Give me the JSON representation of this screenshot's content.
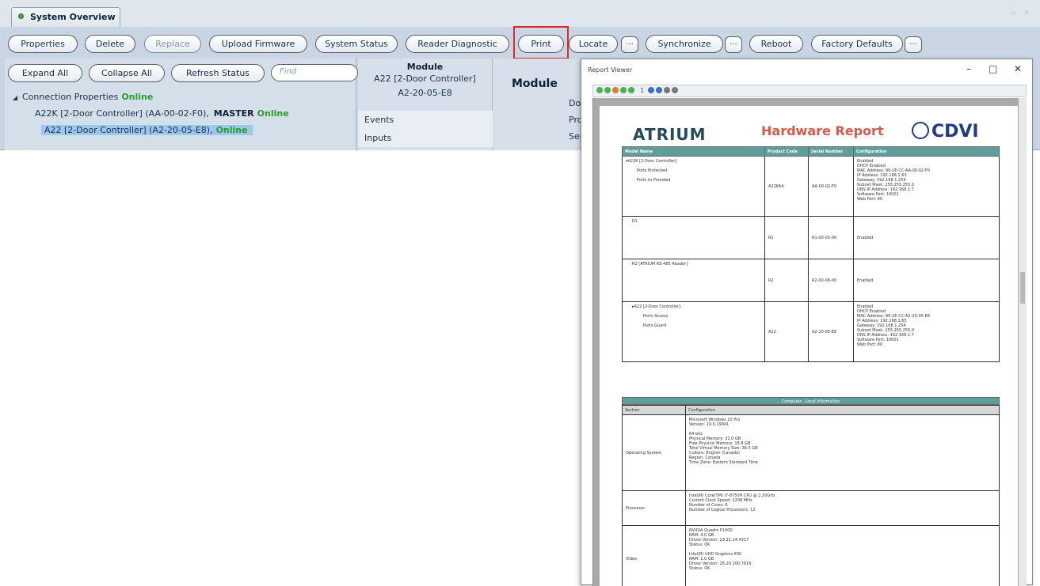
{
  "tab": {
    "title": "System Overview"
  },
  "toolbar": {
    "properties": "Properties",
    "delete": "Delete",
    "replace": "Replace",
    "upload_firmware": "Upload Firmware",
    "system_status": "System Status",
    "reader_diagnostic": "Reader Diagnostic",
    "print": "Print",
    "locate": "Locate",
    "synchronize": "Synchronize",
    "reboot": "Reboot",
    "factory_defaults": "Factory Defaults",
    "more": "..."
  },
  "tree_toolbar": {
    "expand_all": "Expand All",
    "collapse_all": "Collapse All",
    "refresh_status": "Refresh Status",
    "find_placeholder": "Find"
  },
  "tree": {
    "root": {
      "label": "Connection Properties",
      "status": "Online"
    },
    "items": [
      {
        "label": "A22K [2-Door Controller] (AA-00-02-F0),",
        "role": "MASTER",
        "status": "Online"
      },
      {
        "label": "A22 [2-Door Controller] (A2-20-05-E8),",
        "status": "Online"
      }
    ]
  },
  "module_panel": {
    "title": "Module",
    "device": "A22 [2-Door Controller]",
    "address": "A2-20-05-E8",
    "list": [
      "Events",
      "Inputs"
    ]
  },
  "details": {
    "title": "Module",
    "labels": [
      "Do",
      "Pro",
      "Ser"
    ]
  },
  "report_viewer": {
    "window_title": "Report Viewer",
    "page_indicator": "1",
    "header": {
      "brand_left": "ATRIUM",
      "title": "Hardware Report",
      "brand_right": "CDVI"
    },
    "hw_columns": [
      "Model Name",
      "Product Code",
      "Serial Number",
      "Configuration"
    ],
    "hw_rows": [
      {
        "names": [
          "▾A22K [2-Door Controller]",
          "Ports Protected",
          "Ports to Provided"
        ],
        "product": "A22K64",
        "serial": "AA-00-02-F0",
        "config": [
          "Enabled",
          "DHCP Enabled",
          "MAC Address: 90-1E-CC-AA-00-02-F0",
          "IP Address: 192.168.1.63",
          "Gateway: 192.168.1.254",
          "Subnet Mask: 255.255.255.0",
          "DNS IP Address: 192.168.1.7",
          "Software Port: 10001",
          "Web Port: 80"
        ]
      },
      {
        "names": [
          "R1"
        ],
        "product": "R1",
        "serial": "R1-00-05-00",
        "config": [
          "Enabled"
        ]
      },
      {
        "names": [
          "R2 [ATRIUM RS-485 Reader]"
        ],
        "product": "R2",
        "serial": "R2-00-06-00",
        "config": [
          "Enabled"
        ]
      },
      {
        "names": [
          "▸A22 [2-Door Controller]",
          "Ports Access",
          "Ports Guard"
        ],
        "product": "A22",
        "serial": "A2-20-05-E8",
        "config": [
          "Enabled",
          "DHCP Enabled",
          "MAC Address: 90-1E-CC-A2-20-05-E8",
          "IP Address: 192.168.1.65",
          "Gateway: 192.168.1.254",
          "Subnet Mask: 255.255.255.0",
          "DNS IP Address: 192.168.1.7",
          "Software Port: 10001",
          "Web Port: 80"
        ]
      }
    ],
    "pc_section_title": "Computer - Local Information",
    "pc_columns": [
      "Section",
      "Configuration"
    ],
    "pc_rows": [
      {
        "section": "Operating System",
        "config": [
          "Microsoft Windows 10 Pro",
          "Version: 10.0.19041",
          "",
          "64 bits",
          "Physical Memory: 32.0 GB",
          "Free Physical Memory: 18.8 GB",
          "Total Virtual Memory Size: 36.5 GB",
          "Culture: English (Canada)",
          "Region: Canada",
          "Time Zone: Eastern Standard Time"
        ]
      },
      {
        "section": "Processor",
        "config": [
          "Intel(R) Core(TM) i7-8750H CPU @ 2.20GHz",
          "Current Clock Speed: 2208 MHz",
          "Number of Cores: 6",
          "Number of Logical Processors: 12"
        ]
      },
      {
        "section": "Video",
        "config": [
          "NVIDIA Quadro P1000",
          "RAM: 4.0 GB",
          "Driver Version: 23.21.14.4317",
          "Status: OK",
          "",
          "Intel(R) UHD Graphics 630",
          "RAM: 1.0 GB",
          "Driver Version: 26.20.100.7616",
          "Status: OK"
        ]
      }
    ]
  },
  "colors": {
    "app_bg": "#c9d5e2",
    "online": "#2a9d2a",
    "highlight": "#e0262a",
    "table_header": "#5f9e9d",
    "report_title": "#d65a4a",
    "cdvi": "#1f3a8a"
  }
}
